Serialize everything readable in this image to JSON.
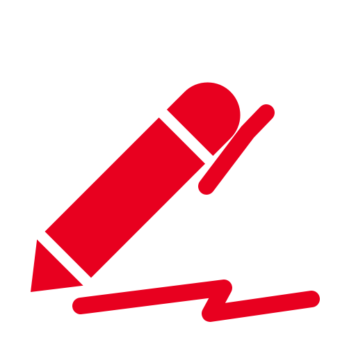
{
  "icon": {
    "name": "pen-signature-icon",
    "color": "#E8001F",
    "background": "#FFFFFF"
  }
}
